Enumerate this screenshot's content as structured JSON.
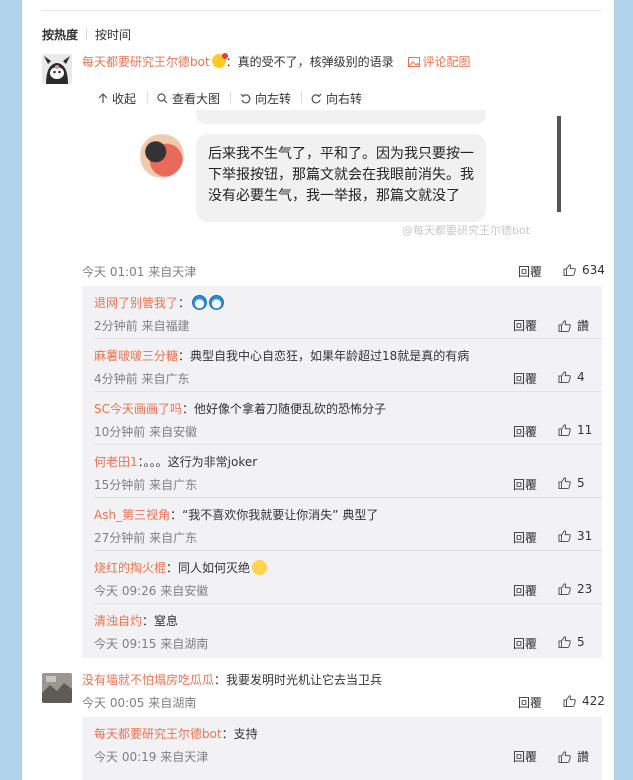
{
  "sort": {
    "hot": "按热度",
    "time": "按时间"
  },
  "main_comment": {
    "user": "每天都要研究王尔德bot",
    "text": "：真的受不了，核弹级别的语录",
    "pic_link": "评论配图",
    "toolbar": [
      "收起",
      "查看大图",
      "向左转",
      "向右转"
    ],
    "bubble_text": "后来我不生气了，平和了。因为我只要按一下举报按钮，那篇文就会在我眼前消失。我没有必要生气，我一举报，那篇文就没了",
    "watermark": "@每天都要研究王尔德bot",
    "time": "今天 01:01 来自天津",
    "reply": "回覆",
    "likes": "634"
  },
  "replies": [
    {
      "user": "退网了别管我了",
      "text": "：",
      "emoji": "doraemon",
      "time": "2分钟前 来自福建",
      "reply": "回覆",
      "likes": "讚"
    },
    {
      "user": "麻薯啵啵三分糖",
      "text": "：典型自我中心自恋狂，如果年龄超过18就是真的有病",
      "time": "4分钟前 来自广东",
      "reply": "回覆",
      "likes": "4"
    },
    {
      "user": "SC今天画画了吗",
      "text": "：他好像个拿着刀随便乱砍的恐怖分子",
      "time": "10分钟前 来自安徽",
      "reply": "回覆",
      "likes": "11"
    },
    {
      "user": "何老田1",
      "text": "：。。。这行为非常joker",
      "time": "15分钟前 来自广东",
      "reply": "回覆",
      "likes": "5"
    },
    {
      "user": "Ash_第三视角",
      "text": "：“我不喜欢你我就要让你消失” 典型了",
      "time": "27分钟前 来自广东",
      "reply": "回覆",
      "likes": "31"
    },
    {
      "user": "烧红的掏火棍",
      "text": "：同人如何灭绝",
      "emoji": "sad",
      "time": "今天 09:26 来自安徽",
      "reply": "回覆",
      "likes": "23"
    },
    {
      "user": "清浊自灼",
      "text": "：窒息",
      "time": "今天 09:15 来自湖南",
      "reply": "回覆",
      "likes": "5"
    }
  ],
  "second_comment": {
    "user": "没有墙就不怕塌房吃瓜瓜",
    "text": "：我要发明时光机让它去当卫兵",
    "time": "今天 00:05 来自湖南",
    "reply": "回覆",
    "likes": "422"
  },
  "second_replies": [
    {
      "user": "每天都要研究王尔德bot",
      "text": "：支持",
      "time": "今天 00:19 来自天津",
      "reply": "回覆",
      "likes": "讚"
    }
  ]
}
